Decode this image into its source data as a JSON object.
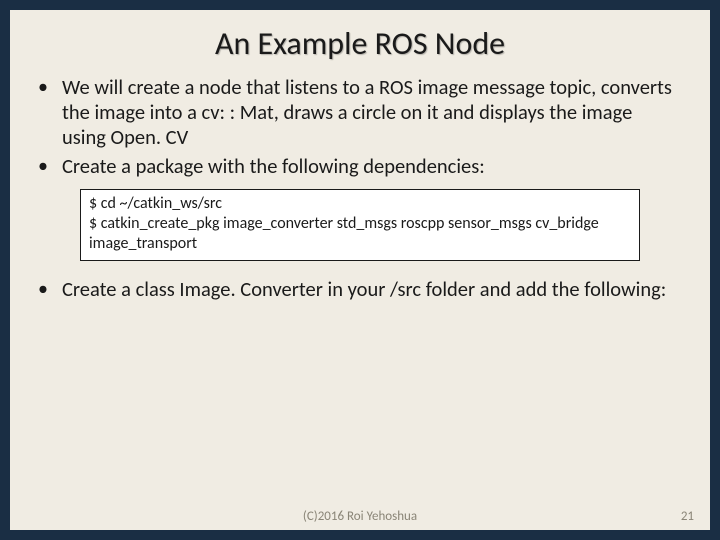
{
  "title": "An Example ROS Node",
  "bullets": {
    "b1": "We will create a node that listens to a ROS image message topic, converts the image into a cv: : Mat, draws a circle on it and displays the image using Open. CV",
    "b2": "Create a package with the following dependencies:",
    "b3": "Create a class Image. Converter in your /src folder and add the following:"
  },
  "code": "$ cd ~/catkin_ws/src\n$ catkin_create_pkg image_converter std_msgs roscpp sensor_msgs cv_bridge image_transport",
  "footer": "(C)2016 Roi Yehoshua",
  "page": "21"
}
